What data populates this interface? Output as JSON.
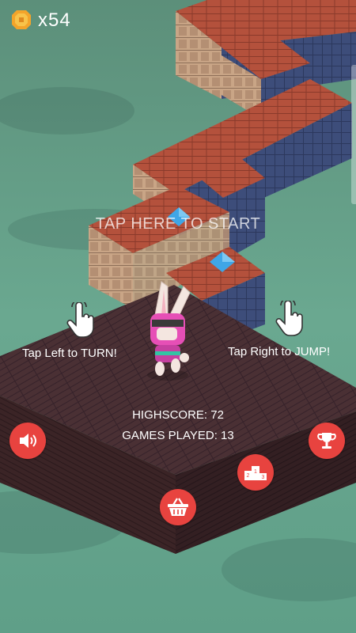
{
  "hud": {
    "coin_count": "x54",
    "tap_to_start": "TAP HERE TO START",
    "hint_left": "Tap Left to TURN!",
    "hint_right": "Tap Right to JUMP!",
    "highscore": "HIGHSCORE: 72",
    "games_played": "GAMES PLAYED: 13"
  },
  "icons": {
    "coin": "coin-icon",
    "hand_left": "tap-hand-icon",
    "hand_right": "tap-hand-icon",
    "sound": "speaker-icon",
    "trophy": "trophy-icon",
    "leaderboard": "podium-icon",
    "shop": "basket-icon"
  },
  "colors": {
    "button": "#e8433f",
    "coin": "#f3a42a",
    "gem": "#3fa6e6",
    "platform": "#4a3034",
    "roof": "#b4513c"
  }
}
